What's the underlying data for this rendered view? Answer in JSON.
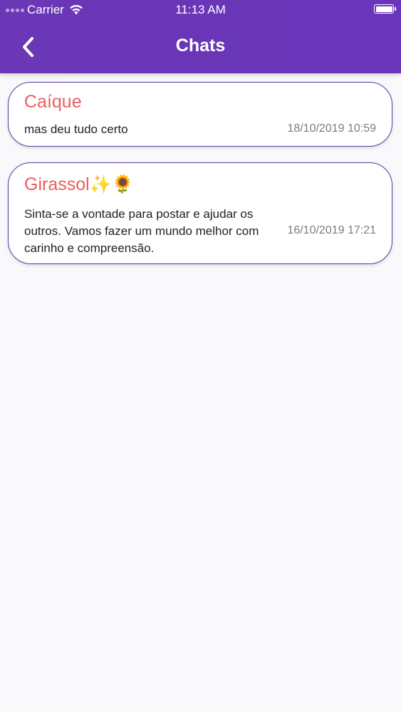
{
  "status_bar": {
    "carrier": "Carrier",
    "time": "11:13 AM"
  },
  "nav": {
    "title": "Chats",
    "back_icon": "chevron-left-icon"
  },
  "chats": [
    {
      "name": "Caíque",
      "message": "mas deu tudo certo",
      "date": "18/10/2019 10:59"
    },
    {
      "name": "Girassol✨🌻",
      "message": "Sinta-se a vontade para postar e ajudar os outros. Vamos fazer um mundo melhor com carinho e compreensão.",
      "date": "16/10/2019 17:21"
    }
  ],
  "colors": {
    "header": "#6a36b8",
    "card_border": "#5b3aa8",
    "name": "#ea5f5b",
    "date": "#7d7d7d"
  }
}
